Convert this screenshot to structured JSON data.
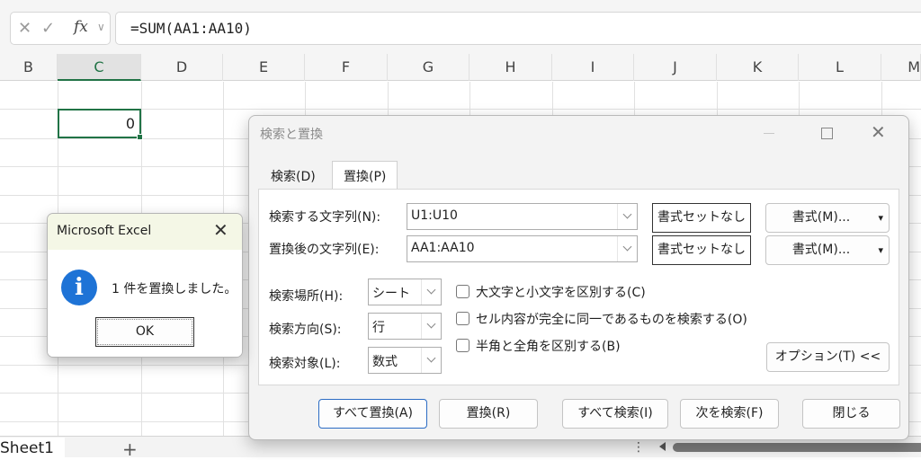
{
  "formula_bar": {
    "cancel_icon": "cancel-x-icon",
    "enter_icon": "checkmark-icon",
    "fx_label": "fx",
    "formula": "=SUM(AA1:AA10)"
  },
  "columns": [
    "B",
    "C",
    "D",
    "E",
    "F",
    "G",
    "H",
    "I",
    "J",
    "K",
    "L",
    "M"
  ],
  "selected_column": "C",
  "active_cell_value": "0",
  "sheet_tabs": {
    "active": "Sheet1",
    "add": "+",
    "more": "⋮"
  },
  "find_replace": {
    "title": "検索と置換",
    "tabs": {
      "find": "検索(D)",
      "replace": "置換(P)"
    },
    "find_label": "検索する文字列(N):",
    "find_value": "U1:U10",
    "replace_label": "置換後の文字列(E):",
    "replace_value": "AA1:AA10",
    "no_format_label": "書式セットなし",
    "format_button": "書式(M)...",
    "within_label": "検索場所(H):",
    "within_value": "シート",
    "search_label": "検索方向(S):",
    "search_value": "行",
    "lookin_label": "検索対象(L):",
    "lookin_value": "数式",
    "match_case": "大文字と小文字を区別する(C)",
    "match_entire": "セル内容が完全に同一であるものを検索する(O)",
    "match_byte": "半角と全角を区別する(B)",
    "options_button": "オプション(T) <<",
    "replace_all": "すべて置換(A)",
    "replace": "置換(R)",
    "find_all": "すべて検索(I)",
    "find_next": "次を検索(F)",
    "close": "閉じる"
  },
  "message_box": {
    "title": "Microsoft Excel",
    "message": "1 件を置換しました。",
    "ok": "OK",
    "icon": "info-icon"
  }
}
